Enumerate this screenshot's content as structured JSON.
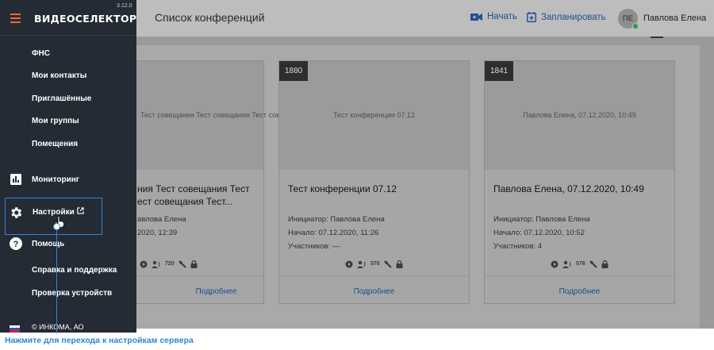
{
  "app": {
    "logo": "ВИДЕОСЕЛЕКТОР",
    "version": "3.12.0",
    "copyright": "© ИНКОМА, АО"
  },
  "header": {
    "title": "Список конференций",
    "start_label": "Начать",
    "schedule_label": "Запланировать",
    "user_initials": "ПЕ",
    "user_name": "Павлова Елена"
  },
  "sidebar": {
    "items": [
      {
        "label": "ФНС"
      },
      {
        "label": "Мои контакты"
      },
      {
        "label": "Приглашённые"
      },
      {
        "label": "Мои группы"
      },
      {
        "label": "Помещения"
      },
      {
        "label": "Мониторинг",
        "icon": "bar-chart-icon"
      },
      {
        "label": "Настройки",
        "icon": "gear-icon",
        "external": "external-link-icon"
      },
      {
        "label": "Помощь",
        "icon": "help-icon"
      },
      {
        "label": "Справка и поддержка"
      },
      {
        "label": "Проверка устройств"
      }
    ]
  },
  "cards": [
    {
      "id": "",
      "thumb_text": "Тест совещания Тест совещания Тест совещания Т",
      "title": "ния Тест совещания Тест\nест совещания Тест...",
      "initiator": "авлова Елена",
      "start": "2020, 12:39",
      "participants": "",
      "more": "Подробнее"
    },
    {
      "id": "1880",
      "thumb_text": "Тест конференции 07.12",
      "title": "Тест конференции 07.12",
      "initiator": "Инициатор: Павлова Елена",
      "start": "Начало: 07.12.2020, 11:26",
      "participants": "Участников: —",
      "more": "Подробнее"
    },
    {
      "id": "1841",
      "thumb_text": "Павлова Елена, 07.12.2020, 10:49",
      "title": "Павлова Елена, 07.12.2020, 10:49",
      "initiator": "Инициатор: Павлова Елена",
      "start": "Начало: 07.12.2020, 10:52",
      "participants": "Участников: 4",
      "more": "Подробнее"
    }
  ],
  "card_icons": {
    "badge_720": "720",
    "badge_576": "576"
  },
  "annotation": {
    "text": "Нажмите для перехода к настройкам сервера"
  },
  "colors": {
    "accent": "#2f86d6",
    "sidebar_bg": "#252b35",
    "brand_orange": "#e96a3a",
    "link": "#1e4f94"
  }
}
